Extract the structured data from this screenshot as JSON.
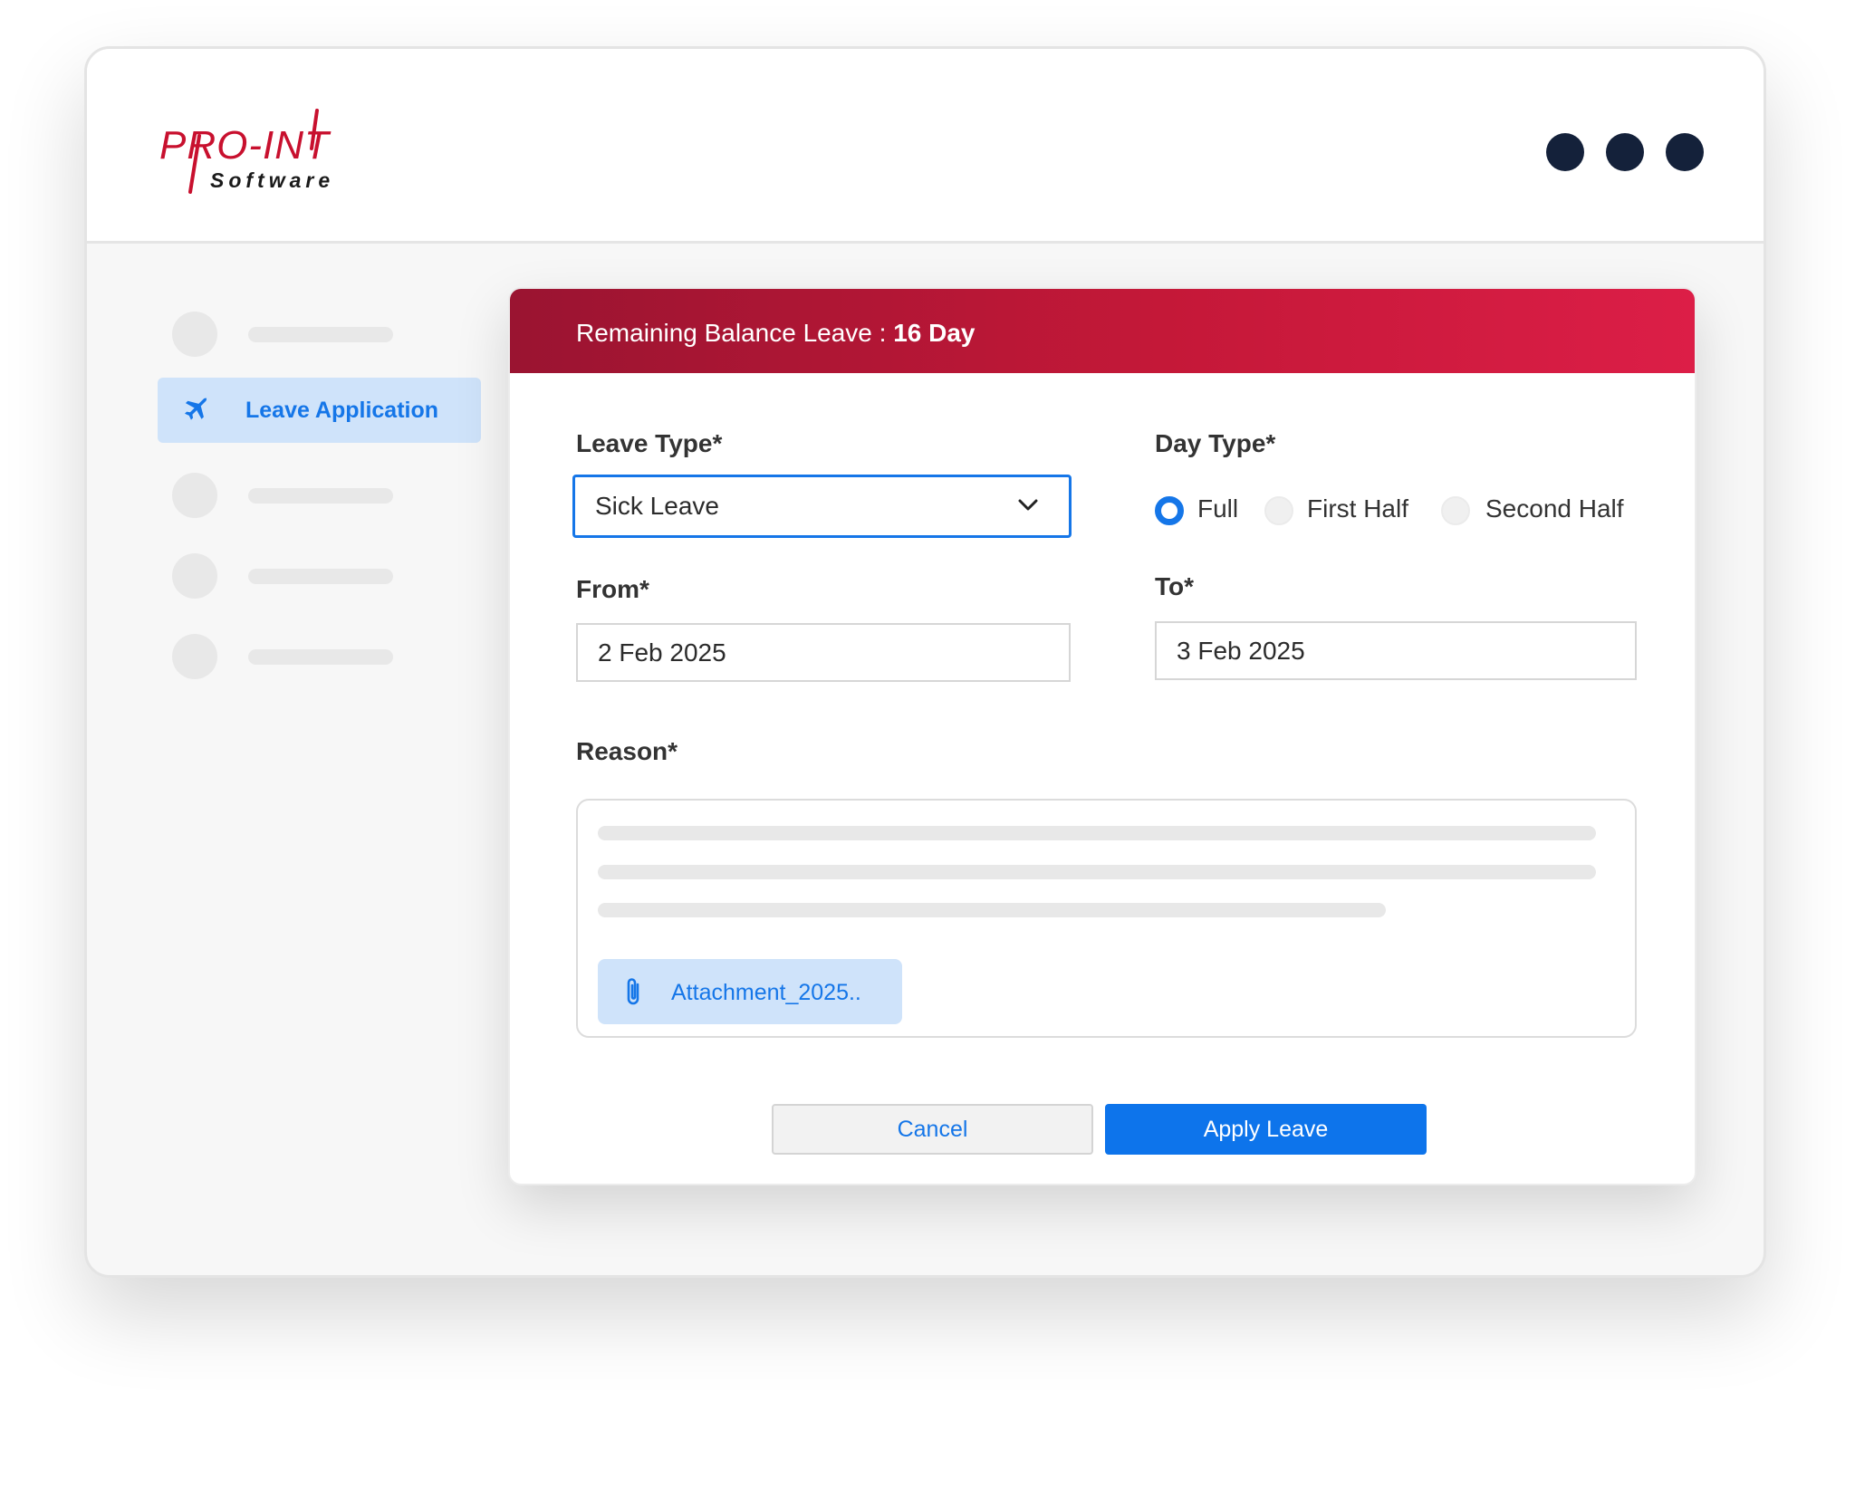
{
  "brand": {
    "logo_main": "PRO-INT",
    "logo_sub": "Software",
    "color": "#c8102e"
  },
  "window_controls": [
    "dot",
    "dot",
    "dot"
  ],
  "sidebar": {
    "active_item": {
      "label": "Leave Application",
      "icon": "airplane-icon"
    }
  },
  "balance": {
    "prefix": "Remaining Balance Leave : ",
    "value": "16 Day"
  },
  "form": {
    "leave_type": {
      "label": "Leave Type*",
      "value": "Sick Leave"
    },
    "day_type": {
      "label": "Day Type*",
      "options": [
        "Full",
        "First Half",
        "Second Half"
      ],
      "selected": "Full"
    },
    "from": {
      "label": "From*",
      "value": "2 Feb 2025"
    },
    "to": {
      "label": "To*",
      "value": "3 Feb 2025"
    },
    "reason": {
      "label": "Reason*",
      "attachment": "Attachment_2025.."
    }
  },
  "actions": {
    "cancel": "Cancel",
    "apply": "Apply Leave"
  },
  "colors": {
    "accent": "#1576e8",
    "header_start": "#9a1431",
    "header_end": "#dc1e47"
  }
}
